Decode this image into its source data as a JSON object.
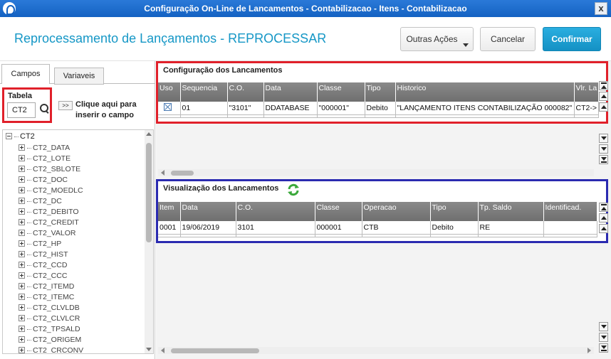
{
  "window": {
    "title": "Configuração On-Line de Lancamentos - Contabilizacao - Itens - Contabilizacao",
    "close_label": "x"
  },
  "header": {
    "page_title": "Reprocessamento de Lançamentos - REPROCESSAR",
    "outras_acoes": "Outras Ações",
    "cancelar": "Cancelar",
    "confirmar": "Confirmar"
  },
  "left": {
    "tabs": [
      "Campos",
      "Variaveis"
    ],
    "tabela_label": "Tabela",
    "tabela_value": "CT2",
    "insert_button": ">>",
    "insert_label": "Clique aqui para inserir o campo",
    "tree_root": "CT2",
    "tree_items": [
      "CT2_DATA",
      "CT2_LOTE",
      "CT2_SBLOTE",
      "CT2_DOC",
      "CT2_MOEDLC",
      "CT2_DC",
      "CT2_DEBITO",
      "CT2_CREDIT",
      "CT2_VALOR",
      "CT2_HP",
      "CT2_HIST",
      "CT2_CCD",
      "CT2_CCC",
      "CT2_ITEMD",
      "CT2_ITEMC",
      "CT2_CLVLDB",
      "CT2_CLVLCR",
      "CT2_TPSALD",
      "CT2_ORIGEM",
      "CT2_CRCONV"
    ]
  },
  "config": {
    "title": "Configuração dos Lancamentos",
    "columns": [
      "Uso",
      "Sequencia",
      "C.O.",
      "Data",
      "Classe",
      "Tipo",
      "Historico",
      "Vlr. La"
    ],
    "rows": [
      [
        "",
        "01",
        "\"3101\"",
        "DDATABASE",
        "\"000001\"",
        "Debito",
        "\"LANÇAMENTO ITENS CONTABILIZAÇÃO 000082\"",
        "CT2->"
      ]
    ]
  },
  "visual": {
    "title": "Visualização dos Lancamentos",
    "columns": [
      "Item",
      "Data",
      "C.O.",
      "Classe",
      "Operacao",
      "Tipo",
      "Tp. Saldo",
      "Identificad."
    ],
    "rows": [
      [
        "0001",
        "19/06/2019",
        "3101",
        "000001",
        "CTB",
        "Debito",
        "RE",
        ""
      ]
    ]
  }
}
